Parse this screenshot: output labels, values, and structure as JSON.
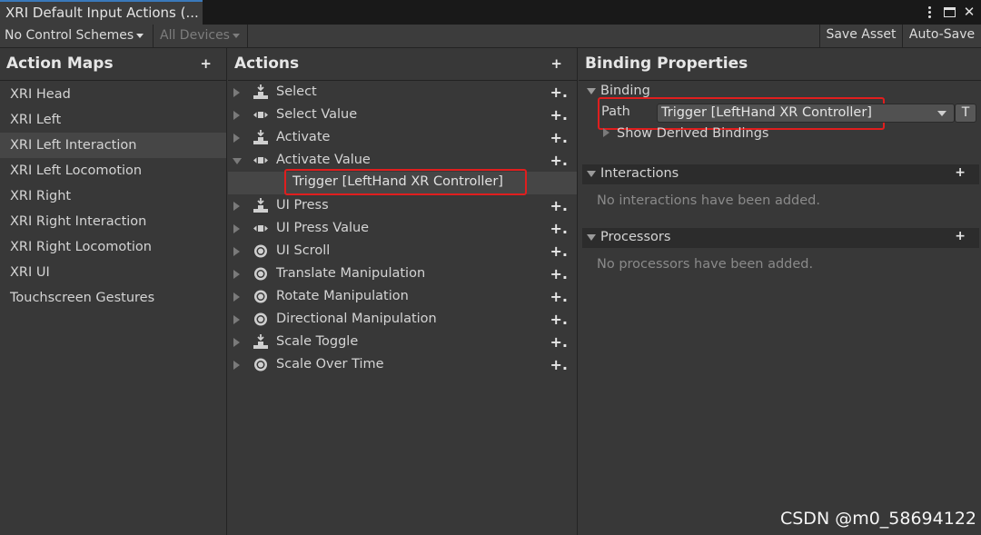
{
  "window": {
    "tab_title": "XRI Default Input Actions (...",
    "menu_icon": "kebab-menu-icon",
    "maximize_icon": "maximize-icon",
    "close_symbol": "✕"
  },
  "toolbar": {
    "control_scheme": "No Control Schemes",
    "devices": "All Devices",
    "save_asset": "Save Asset",
    "auto_save": "Auto-Save"
  },
  "action_maps": {
    "title": "Action Maps",
    "add_symbol": "+",
    "items": [
      {
        "label": "XRI Head",
        "selected": false
      },
      {
        "label": "XRI Left",
        "selected": false
      },
      {
        "label": "XRI Left Interaction",
        "selected": true
      },
      {
        "label": "XRI Left Locomotion",
        "selected": false
      },
      {
        "label": "XRI Right",
        "selected": false
      },
      {
        "label": "XRI Right Interaction",
        "selected": false
      },
      {
        "label": "XRI Right Locomotion",
        "selected": false
      },
      {
        "label": "XRI UI",
        "selected": false
      },
      {
        "label": "Touchscreen Gestures",
        "selected": false
      }
    ]
  },
  "actions": {
    "title": "Actions",
    "add_symbol": "+",
    "add_binding_symbol": "+.",
    "items": [
      {
        "label": "Select",
        "icon": "button-action-icon",
        "expanded": false
      },
      {
        "label": "Select Value",
        "icon": "value-action-icon",
        "expanded": false
      },
      {
        "label": "Activate",
        "icon": "button-action-icon",
        "expanded": false
      },
      {
        "label": "Activate Value",
        "icon": "value-action-icon",
        "expanded": true
      },
      {
        "label": "UI Press",
        "icon": "button-action-icon",
        "expanded": false
      },
      {
        "label": "UI Press Value",
        "icon": "value-action-icon",
        "expanded": false
      },
      {
        "label": "UI Scroll",
        "icon": "passthrough-action-icon",
        "expanded": false
      },
      {
        "label": "Translate Manipulation",
        "icon": "passthrough-action-icon",
        "expanded": false
      },
      {
        "label": "Rotate Manipulation",
        "icon": "passthrough-action-icon",
        "expanded": false
      },
      {
        "label": "Directional Manipulation",
        "icon": "passthrough-action-icon",
        "expanded": false
      },
      {
        "label": "Scale Toggle",
        "icon": "button-action-icon",
        "expanded": false
      },
      {
        "label": "Scale Over Time",
        "icon": "passthrough-action-icon",
        "expanded": false
      }
    ],
    "binding": "Trigger [LeftHand XR Controller]"
  },
  "binding_properties": {
    "title": "Binding Properties",
    "binding_section": "Binding",
    "path_label": "Path",
    "path_value": "Trigger [LeftHand XR Controller]",
    "t_button": "T",
    "show_derived": "Show Derived Bindings",
    "interactions_title": "Interactions",
    "interactions_empty": "No interactions have been added.",
    "processors_title": "Processors",
    "processors_empty": "No processors have been added.",
    "add_symbol": "+"
  },
  "watermark": "CSDN @m0_58694122",
  "colors": {
    "highlight_box": "#e01e1e",
    "tab_accent": "#3a79bb",
    "panel_bg": "#383838",
    "selected_row": "#464646"
  }
}
